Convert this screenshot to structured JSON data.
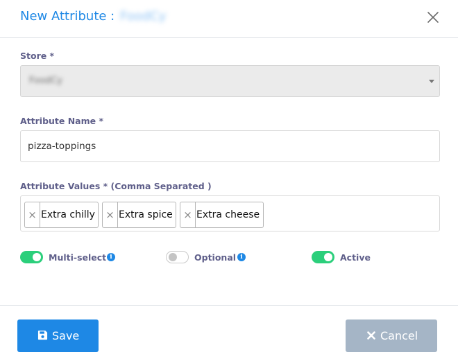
{
  "header": {
    "title": "New Attribute : ",
    "store_name_blurred": "FoodCy"
  },
  "store": {
    "label": "Store *",
    "value_blurred": "FoodCy"
  },
  "attribute_name": {
    "label": "Attribute Name *",
    "value": "pizza-toppings"
  },
  "attribute_values": {
    "label": "Attribute Values * (Comma Separated )",
    "tags": [
      "Extra chilly",
      "Extra spice",
      "Extra cheese"
    ],
    "remove_glyph": "×"
  },
  "toggles": {
    "multi_select": {
      "label": "Multi-select",
      "state": "on"
    },
    "optional": {
      "label": "Optional",
      "state": "off"
    },
    "active": {
      "label": "Active",
      "state": "on"
    },
    "info_glyph": "i"
  },
  "footer": {
    "save_label": "Save",
    "cancel_label": "Cancel"
  },
  "colors": {
    "primary": "#1e88e5",
    "toggle_on": "#2bcf7b",
    "cancel_button": "#a5b5c6",
    "label_text": "#5f5f8a"
  },
  "icons": {
    "close": "close-icon",
    "save": "floppy-disk-icon",
    "cancel": "x-icon",
    "info": "info-icon",
    "caret": "chevron-down-icon"
  }
}
